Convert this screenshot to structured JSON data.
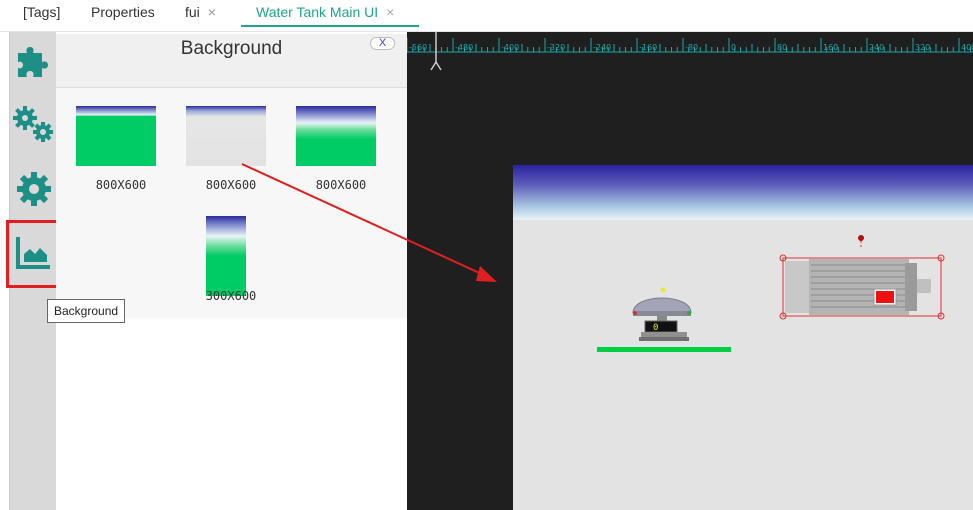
{
  "tabs": [
    {
      "label": "[Tags]",
      "closable": false,
      "active": false
    },
    {
      "label": "Properties",
      "closable": false,
      "active": false
    },
    {
      "label": "fui",
      "closable": true,
      "active": false
    },
    {
      "label": "Water Tank Main UI",
      "closable": true,
      "active": true
    }
  ],
  "tab_close_glyph": "×",
  "rail": {
    "items": [
      {
        "icon": "puzzle-icon"
      },
      {
        "icon": "gears-icon"
      },
      {
        "icon": "gear-icon"
      },
      {
        "icon": "area-chart-icon",
        "selected": true
      }
    ],
    "accent": "#1e8f86",
    "highlight": "#e02020"
  },
  "tooltip": {
    "text": "Background"
  },
  "panel": {
    "title": "Background",
    "close_label": "X",
    "thumbnails": [
      {
        "label": "800X600",
        "style": "green"
      },
      {
        "label": "800X600",
        "style": "gray"
      },
      {
        "label": "800X600",
        "style": "green-fade"
      },
      {
        "label": "300X600",
        "style": "tall-green"
      }
    ]
  },
  "ruler": {
    "ticks": [
      "-560",
      "-480",
      "-400",
      "-320",
      "-240",
      "-160",
      "-80",
      "0",
      "80",
      "160",
      "240",
      "320",
      "400"
    ],
    "color": "#1aa7a7"
  },
  "canvas": {
    "pump_readout": "0",
    "colors": {
      "band_top": "#2b229f",
      "floor": "#e3e3e3",
      "level_bar": "#00cc55",
      "selection": "#e03030"
    }
  }
}
